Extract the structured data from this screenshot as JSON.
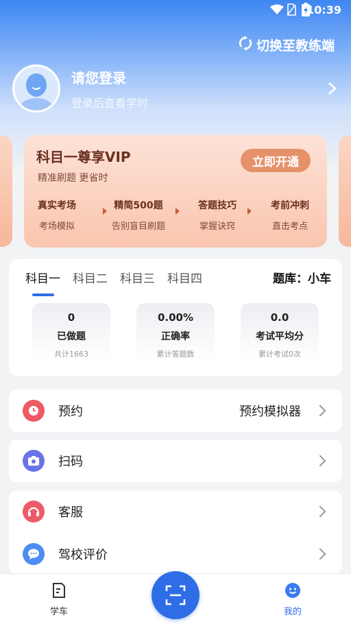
{
  "status_bar": {
    "time": "10:39"
  },
  "header": {
    "switch_label": "切换至教练端"
  },
  "profile": {
    "name": "请您登录",
    "subtitle": "登录后查看学时"
  },
  "vip": {
    "title": "科目一尊享VIP",
    "subtitle": "精准刷题 更省时",
    "button": "立即开通",
    "features": [
      {
        "title": "真实考场",
        "desc": "考场模拟"
      },
      {
        "title": "精简500题",
        "desc": "告别盲目刷题"
      },
      {
        "title": "答题技巧",
        "desc": "掌握诀窍"
      },
      {
        "title": "考前冲刺",
        "desc": "直击考点"
      }
    ]
  },
  "subjects": {
    "tabs": [
      "科目一",
      "科目二",
      "科目三",
      "科目四"
    ],
    "active_index": 0,
    "bank_label": "题库：小车"
  },
  "stats": [
    {
      "value": "0",
      "label": "已做题",
      "note": "共计1663"
    },
    {
      "value": "0.00%",
      "label": "正确率",
      "note": "累计答题数"
    },
    {
      "value": "0.0",
      "label": "考试平均分",
      "note": "累计考试0次"
    }
  ],
  "menu": {
    "reserve": {
      "label": "预约",
      "extra": "预约模拟器"
    },
    "scan": {
      "label": "扫码"
    },
    "service": {
      "label": "客服"
    },
    "review": {
      "label": "驾校评价"
    }
  },
  "tabbar": {
    "learn": "学车",
    "mine": "我的"
  },
  "colors": {
    "accent": "#2f6de6",
    "vip_button": "#e5926b",
    "reserve_icon": "#ec5a63",
    "scan_icon": "#6a72e8",
    "service_icon": "#ee5a6a",
    "review_icon": "#4d8cf0"
  }
}
